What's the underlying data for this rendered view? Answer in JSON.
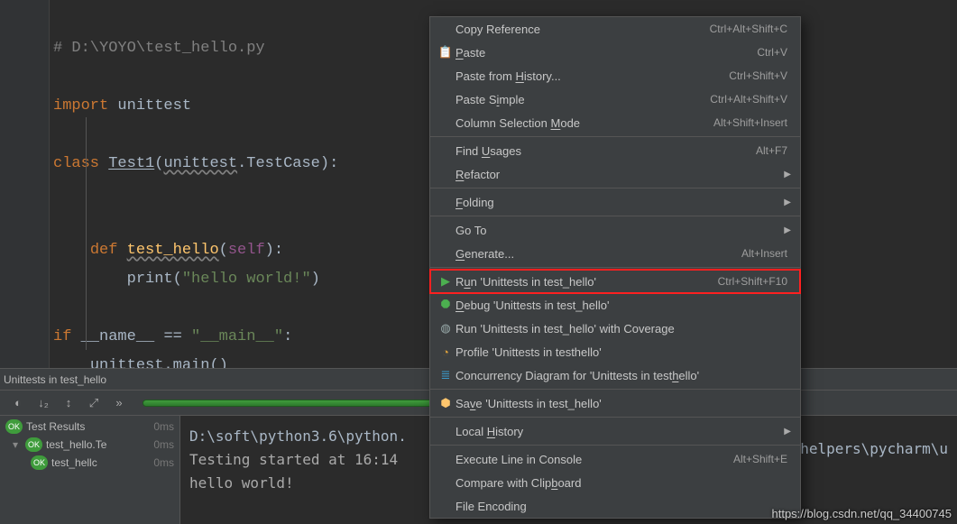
{
  "code": {
    "l1": "# D:\\YOYO\\test_hello.py",
    "l3a": "import",
    "l3b": " unittest",
    "l5a": "class ",
    "l5b": "Test1",
    "l5c": "(",
    "l5d": "unittest",
    "l5e": ".TestCase):",
    "l8a": "def ",
    "l8b": "test_hello",
    "l8c": "(",
    "l8d": "self",
    "l8e": "):",
    "l9a": "print",
    "l9b": "(",
    "l9c": "\"hello world!\"",
    "l9d": ")",
    "l11a": "if ",
    "l11b": "__name__ ",
    "l11c": "== ",
    "l11d": "\"__main__\"",
    "l11e": ":",
    "l12a": "unittest.main",
    "l12b": "()"
  },
  "run_title": "Unittests in test_hello",
  "tree": {
    "root": {
      "label": "Test Results",
      "time": "0ms"
    },
    "n1": {
      "label": "test_hello.Te",
      "time": "0ms"
    },
    "n2": {
      "label": "test_hellc",
      "time": "0ms"
    }
  },
  "console": {
    "l1": "D:\\soft\\python3.6\\python.",
    "l2": "Testing started at 16:14",
    "l3": "hello world!",
    "right": "helpers\\pycharm\\u"
  },
  "ctx": {
    "copy_ref": {
      "label": "Copy Reference",
      "sc": "Ctrl+Alt+Shift+C"
    },
    "paste": {
      "label": "Paste",
      "mn": "P",
      "sc": "Ctrl+V"
    },
    "paste_hist": {
      "label": "Paste from History...",
      "mn": "H",
      "sc": "Ctrl+Shift+V"
    },
    "paste_simple": {
      "label": "Paste Simple",
      "mn": "i",
      "sc": "Ctrl+Alt+Shift+V"
    },
    "col_sel": {
      "label": "Column Selection Mode",
      "mn": "M",
      "sc": "Alt+Shift+Insert"
    },
    "find_usages": {
      "label": "Find Usages",
      "mn": "U",
      "sc": "Alt+F7"
    },
    "refactor": {
      "label": "Refactor",
      "mn": "R"
    },
    "folding": {
      "label": "Folding",
      "mn": "F"
    },
    "goto": {
      "label": "Go To"
    },
    "generate": {
      "label": "Generate...",
      "mn": "G",
      "sc": "Alt+Insert"
    },
    "run": {
      "label": "Run 'Unittests in test_hello'",
      "mn": "u",
      "sc": "Ctrl+Shift+F10"
    },
    "debug": {
      "label": "Debug 'Unittests in test_hello'",
      "mn": "D"
    },
    "cover": {
      "label": "Run 'Unittests in test_hello' with Coverage"
    },
    "profile": {
      "label": "Profile 'Unittests in testhello'"
    },
    "conc": {
      "label": "Concurrency Diagram for  'Unittests in testhello'",
      "mn": "h"
    },
    "save": {
      "label": "Save 'Unittests in test_hello'",
      "mn": "v"
    },
    "local_hist": {
      "label": "Local History",
      "mn": "H"
    },
    "exec_line": {
      "label": "Execute Line in Console",
      "sc": "Alt+Shift+E"
    },
    "clip": {
      "label": "Compare with Clipboard",
      "mn": "b"
    },
    "file_enc": {
      "label": "File Encoding"
    }
  },
  "watermark": "https://blog.csdn.net/qq_34400745"
}
